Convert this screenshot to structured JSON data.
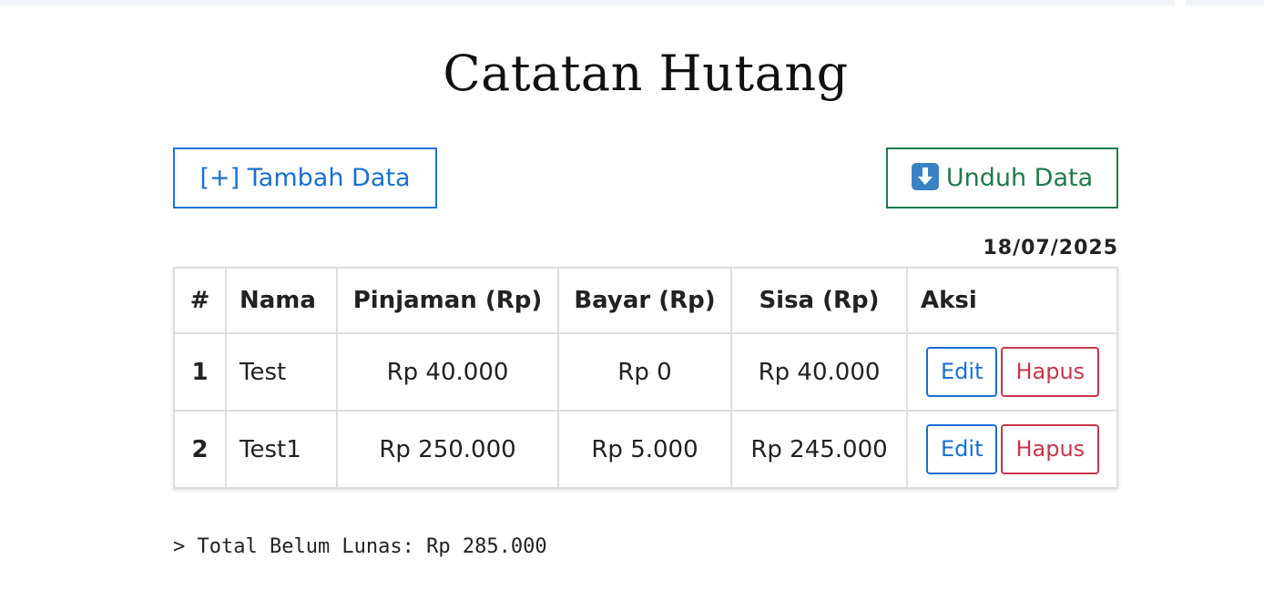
{
  "page": {
    "title": "Catatan Hutang",
    "date": "18/07/2025"
  },
  "toolbar": {
    "add_label": "[+] Tambah Data",
    "download_label": "Unduh Data",
    "download_icon": "download-arrow-icon"
  },
  "table": {
    "headers": [
      "#",
      "Nama",
      "Pinjaman (Rp)",
      "Bayar (Rp)",
      "Sisa (Rp)",
      "Aksi"
    ],
    "rows": [
      {
        "no": "1",
        "nama": "Test",
        "pinjaman": "Rp 40.000",
        "bayar": "Rp 0",
        "sisa": "Rp 40.000",
        "edit": "Edit",
        "hapus": "Hapus"
      },
      {
        "no": "2",
        "nama": "Test1",
        "pinjaman": "Rp 250.000",
        "bayar": "Rp 5.000",
        "sisa": "Rp 245.000",
        "edit": "Edit",
        "hapus": "Hapus"
      }
    ]
  },
  "summary": {
    "total_text": "> Total Belum Lunas: Rp 285.000"
  },
  "colors": {
    "primary": "#1a6fd1",
    "success": "#1f7a4d",
    "danger": "#c8364a",
    "border": "#dedede"
  }
}
